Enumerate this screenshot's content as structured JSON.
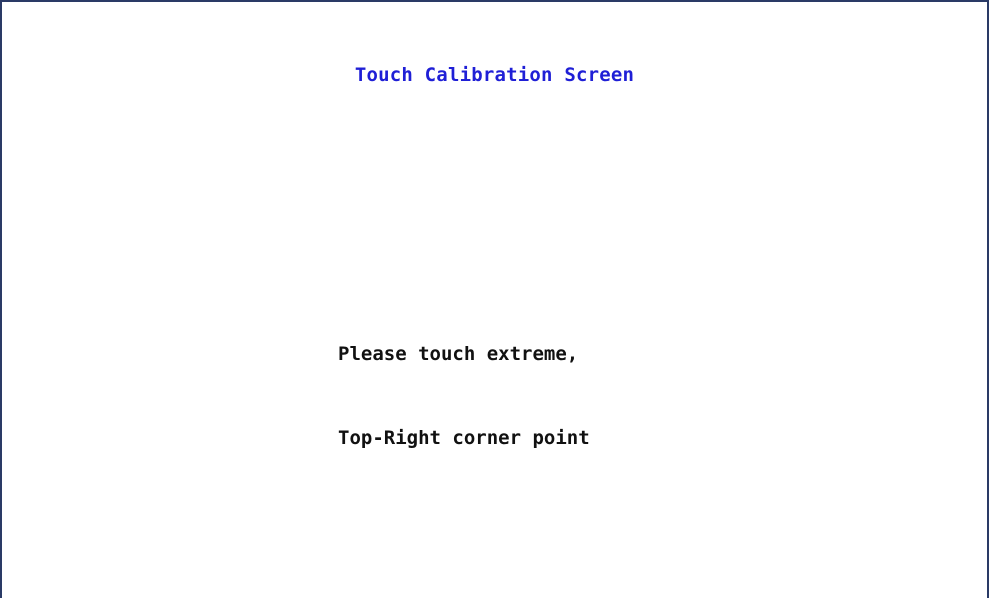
{
  "screen": {
    "title": "Touch Calibration Screen",
    "instruction_line1": "Please touch extreme,",
    "instruction_line2": "Top-Right corner point"
  },
  "colors": {
    "title": "#1f1fd6",
    "text": "#111111",
    "border": "#2a3a66",
    "background": "#ffffff"
  }
}
